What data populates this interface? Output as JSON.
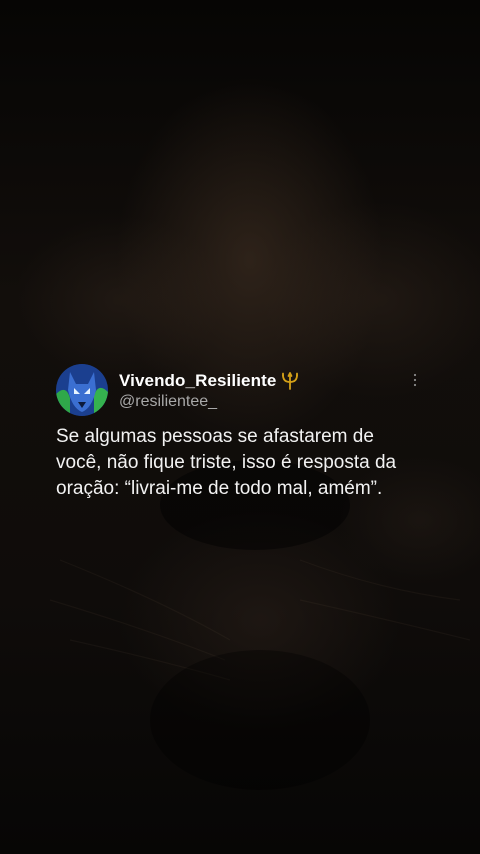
{
  "post": {
    "display_name": "Vivendo_Resiliente",
    "name_emoji": "trident-icon",
    "handle": "@resilientee_",
    "text": "Se algumas pessoas se afastarem de\nvocê, não fique triste, isso é resposta da\noração: “livrai-me de todo mal, amém”.",
    "menu_icon": "more-vertical-icon",
    "avatar_icon": "wolf-avatar"
  },
  "colors": {
    "background": "#0b0807",
    "text": "#f2f2f2",
    "handle": "#a8a8a8",
    "trident": "#d4a017"
  }
}
